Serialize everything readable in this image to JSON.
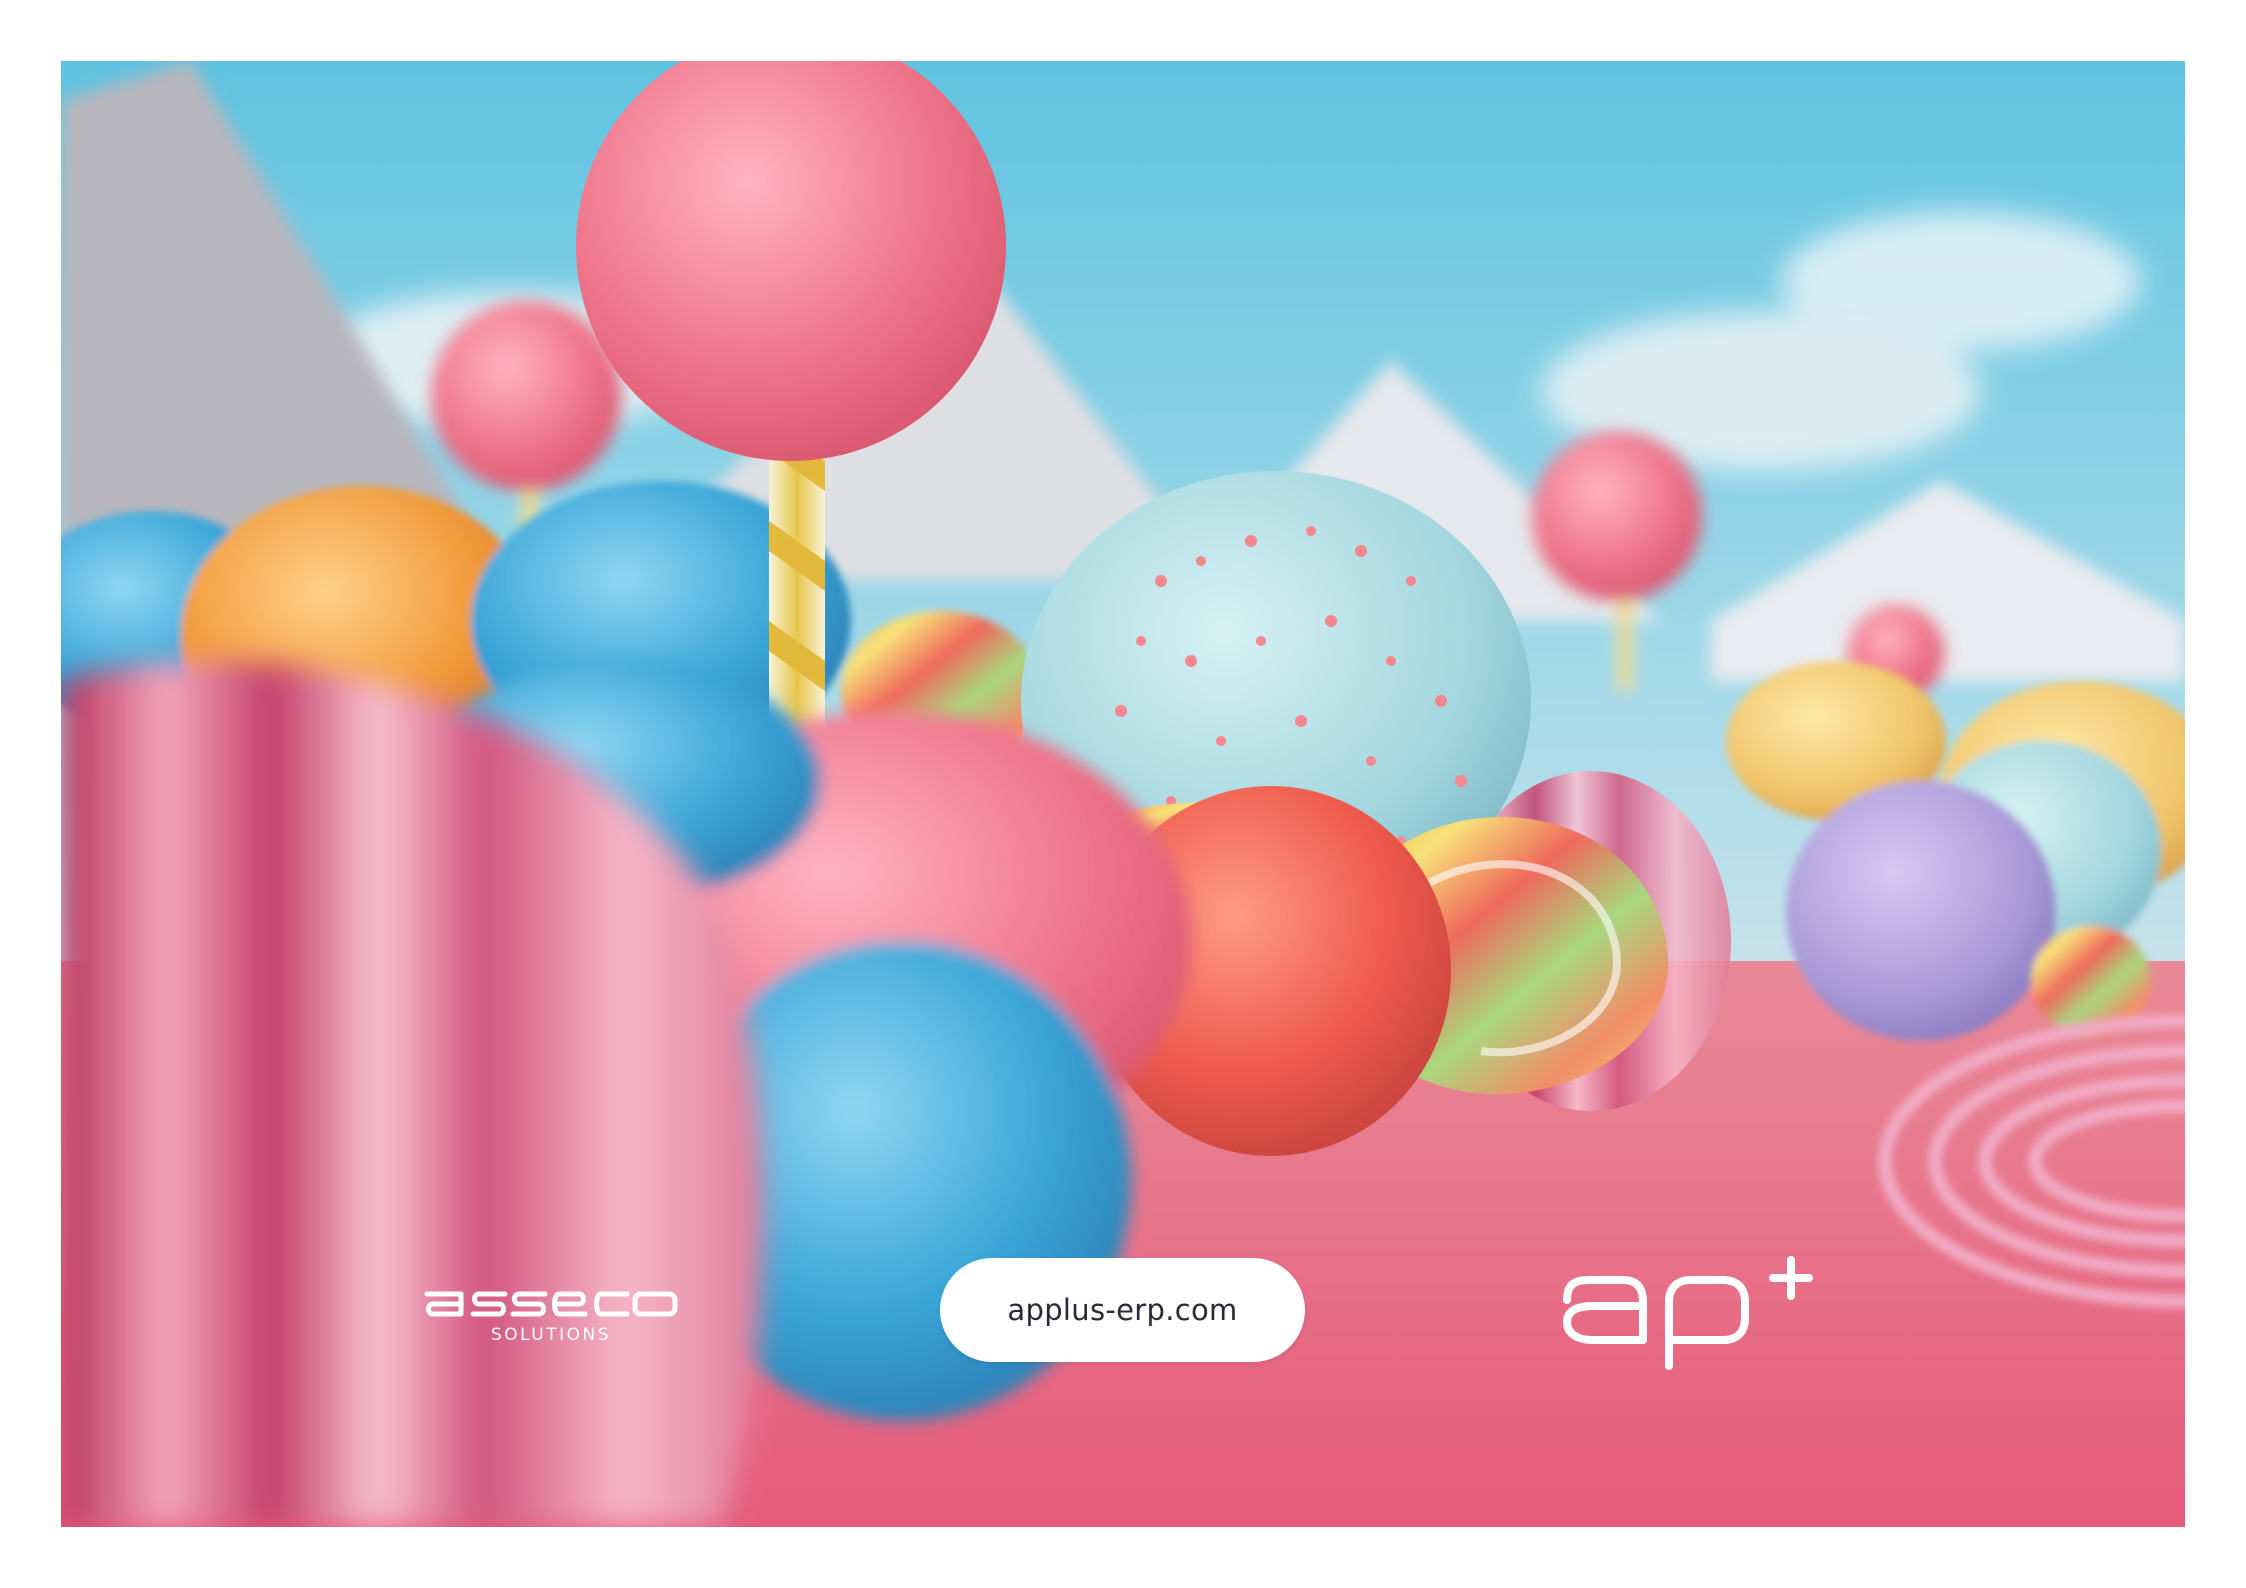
{
  "branding": {
    "left_logo_mark": "asseco",
    "left_logo_subtitle": "SOLUTIONS",
    "right_logo_mark": "ap+"
  },
  "cta": {
    "url": "applus-erp.com"
  },
  "scene": {
    "subject": "candy-landscape-illustration",
    "colors": {
      "sky": "#5fc3e0",
      "ground": "#e8708a",
      "candy_pink": "#f0768c",
      "candy_blue": "#3aa6d8",
      "candy_orange": "#f19a3a"
    }
  }
}
